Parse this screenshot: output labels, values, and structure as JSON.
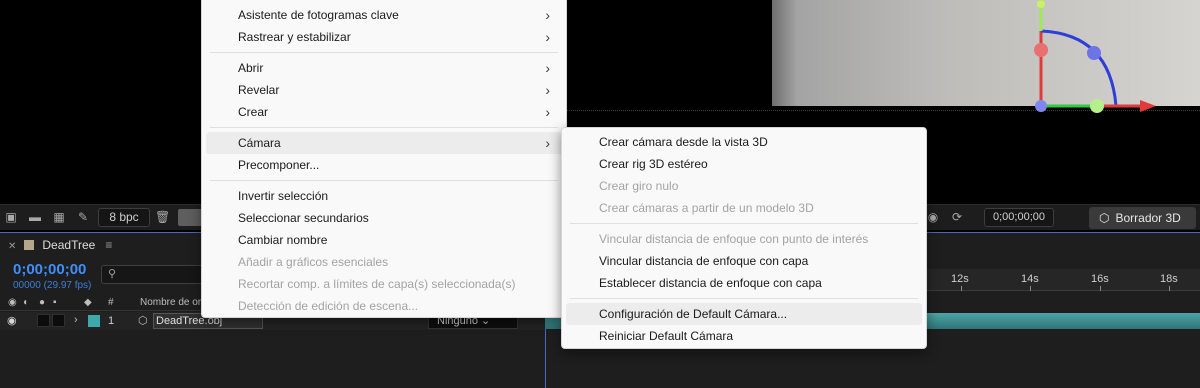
{
  "context_menu": {
    "items": [
      {
        "label": "Asistente de fotogramas clave",
        "submenu": true,
        "enabled": true
      },
      {
        "label": "Rastrear y estabilizar",
        "submenu": true,
        "enabled": true
      },
      {
        "label": "Abrir",
        "submenu": true,
        "enabled": true
      },
      {
        "label": "Revelar",
        "submenu": true,
        "enabled": true
      },
      {
        "label": "Crear",
        "submenu": true,
        "enabled": true
      },
      {
        "label": "Cámara",
        "submenu": true,
        "enabled": true,
        "highlighted": true
      },
      {
        "label": "Precomponer...",
        "submenu": false,
        "enabled": true
      },
      {
        "label": "Invertir selección",
        "submenu": false,
        "enabled": true
      },
      {
        "label": "Seleccionar secundarios",
        "submenu": false,
        "enabled": true
      },
      {
        "label": "Cambiar nombre",
        "submenu": false,
        "enabled": true
      },
      {
        "label": "Añadir a gráficos esenciales",
        "submenu": false,
        "enabled": false
      },
      {
        "label": "Recortar comp. a límites de capa(s) seleccionada(s)",
        "submenu": false,
        "enabled": false
      },
      {
        "label": "Detección de edición de escena...",
        "submenu": false,
        "enabled": false
      }
    ]
  },
  "camera_submenu": {
    "items": [
      {
        "label": "Crear cámara desde la vista 3D",
        "enabled": true
      },
      {
        "label": "Crear rig 3D estéreo",
        "enabled": true
      },
      {
        "label": "Crear giro nulo",
        "enabled": false
      },
      {
        "label": "Crear cámaras a partir de un modelo 3D",
        "enabled": false
      },
      {
        "label": "Vincular distancia de enfoque con punto de interés",
        "enabled": false
      },
      {
        "label": "Vincular distancia de enfoque con capa",
        "enabled": true
      },
      {
        "label": "Establecer distancia de enfoque con capa",
        "enabled": true
      },
      {
        "label": "Configuración de Default Cámara...",
        "enabled": true,
        "highlighted": true
      },
      {
        "label": "Reiniciar Default Cámara",
        "enabled": true
      }
    ]
  },
  "viewer_toolbar": {
    "bpc": "8 bpc",
    "timecode": "0;00;00;00",
    "renderer_label": "Borrador 3D"
  },
  "composition_panel": {
    "tab_name": "DeadTree",
    "current_time": "0;00;00;00",
    "fps_label": "00000 (29.97 fps)",
    "search_placeholder": "",
    "layer_columns": {
      "number": "#",
      "source_name": "Nombre de ori"
    },
    "layer": {
      "number": "1",
      "name": "DeadTree.obj",
      "parent": "Ninguno",
      "label_color": "#3ea9ad"
    },
    "ruler_labels": [
      "12s",
      "14s",
      "16s",
      "18s"
    ]
  },
  "colors": {
    "timecode_blue": "#3d8fff",
    "panel_accent": "#4a66c7",
    "track_teal": "#3ea9ad"
  }
}
